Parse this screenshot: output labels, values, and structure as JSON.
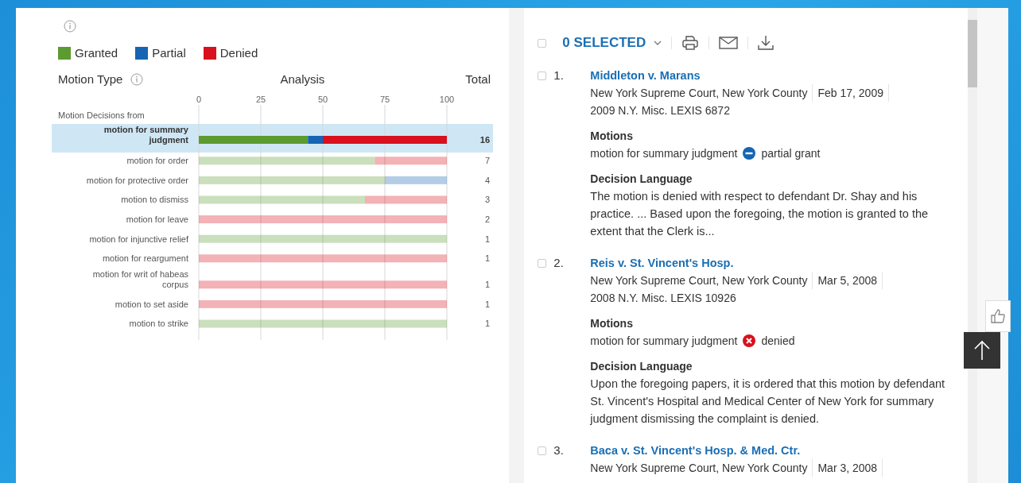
{
  "header": {
    "motion_type": "Motion Type",
    "analysis": "Analysis",
    "total": "Total"
  },
  "chart_data": {
    "type": "bar",
    "orientation": "horizontal",
    "stacked": true,
    "grid": true,
    "ylabel": "Motion Decisions from",
    "xlim": [
      0,
      100
    ],
    "xticks": [
      0,
      25,
      50,
      75,
      100
    ],
    "categories": [
      "motion for summary judgment",
      "motion for order",
      "motion for protective order",
      "motion to dismiss",
      "motion for leave",
      "motion for injunctive relief",
      "motion for reargument",
      "motion for writ of habeas corpus",
      "motion to set aside",
      "motion to strike"
    ],
    "series": [
      {
        "name": "Granted",
        "color": "#5b9b2f",
        "values": [
          44,
          71,
          75,
          67,
          0,
          100,
          0,
          0,
          0,
          100
        ]
      },
      {
        "name": "Partial",
        "color": "#1565b4",
        "values": [
          6,
          0,
          25,
          0,
          0,
          0,
          0,
          0,
          0,
          0
        ]
      },
      {
        "name": "Denied",
        "color": "#d9101d",
        "values": [
          50,
          29,
          0,
          33,
          100,
          0,
          100,
          100,
          100,
          0
        ]
      }
    ]
  },
  "rows": [
    {
      "total": "16",
      "selected": true
    },
    {
      "total": "7",
      "selected": false
    },
    {
      "total": "4",
      "selected": false
    },
    {
      "total": "3",
      "selected": false
    },
    {
      "total": "2",
      "selected": false
    },
    {
      "total": "1",
      "selected": false
    },
    {
      "total": "1",
      "selected": false
    },
    {
      "total": "1",
      "selected": false
    },
    {
      "total": "1",
      "selected": false
    },
    {
      "total": "1",
      "selected": false
    }
  ],
  "results": {
    "select_all_checked": false,
    "selected_label": "0 SELECTED",
    "items": [
      {
        "checked": false,
        "number": "1.",
        "title": "Middleton v. Marans",
        "court": "New York Supreme Court, New York County",
        "date": "Feb 17, 2009",
        "citation": "2009 N.Y. Misc. LEXIS 6872",
        "motions_heading": "Motions",
        "motion": "motion for summary judgment",
        "outcome": {
          "kind": "partial",
          "label": "partial grant"
        },
        "decision_heading": "Decision Language",
        "decision": "The motion is denied with respect to defendant Dr. Shay and his practice. ... Based upon the foregoing, the motion is granted to the extent that the Clerk is..."
      },
      {
        "checked": false,
        "number": "2.",
        "title": "Reis v. St. Vincent's Hosp.",
        "court": "New York Supreme Court, New York County",
        "date": "Mar 5, 2008",
        "citation": "2008 N.Y. Misc. LEXIS 10926",
        "motions_heading": "Motions",
        "motion": "motion for summary judgment",
        "outcome": {
          "kind": "denied",
          "label": "denied"
        },
        "decision_heading": "Decision Language",
        "decision": "Upon the foregoing papers, it is ordered that this motion by defendant St. Vincent's Hospital and Medical Center of New York for summary judgment dismissing the complaint is denied."
      },
      {
        "checked": false,
        "number": "3.",
        "title": "Baca v. St. Vincent's Hosp. & Med. Ctr.",
        "court": "New York Supreme Court, New York County",
        "date": "Mar 3, 2008"
      }
    ]
  }
}
